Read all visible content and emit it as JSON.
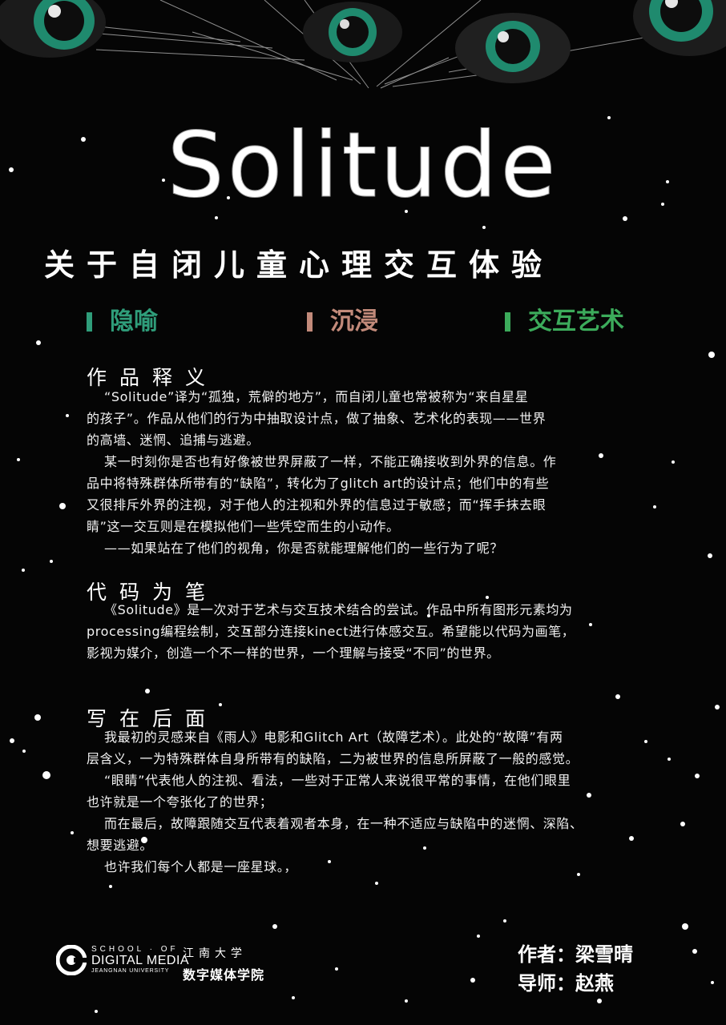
{
  "title": "Solitude",
  "subtitle": "关于自闭儿童心理交互体验",
  "tags": [
    {
      "label": "隐喻",
      "color": "#2f9d7a"
    },
    {
      "label": "沉浸",
      "color": "#c28a7a"
    },
    {
      "label": "交互艺术",
      "color": "#3cab5b"
    }
  ],
  "sections": [
    {
      "heading": "作品释义",
      "lines": [
        "“Solitude”译为“孤独，荒僻的地方”，而自闭儿童也常被称为“来自星星",
        "的孩子”。作品从他们的行为中抽取设计点，做了抽象、艺术化的表现——世界",
        "的高墙、迷惘、追捕与逃避。",
        "某一时刻你是否也有好像被世界屏蔽了一样，不能正确接收到外界的信息。作",
        "品中将特殊群体所带有的“缺陷”，转化为了glitch art的设计点；他们中的有些",
        "又很排斥外界的注视，对于他人的注视和外界的信息过于敏感；而“挥手抹去眼",
        "睛”这一交互则是在模拟他们一些凭空而生的小动作。",
        "——如果站在了他们的视角，你是否就能理解他们的一些行为了呢？"
      ]
    },
    {
      "heading": "代码为笔",
      "lines": [
        "《Solitude》是一次对于艺术与交互技术结合的尝试。作品中所有图形元素均为",
        "processing编程绘制，交互部分连接kinect进行体感交互。希望能以代码为画笔，",
        "影视为媒介，创造一个不一样的世界，一个理解与接受“不同”的世界。"
      ]
    },
    {
      "heading": "写在后面",
      "lines": [
        "我最初的灵感来自《雨人》电影和Glitch Art（故障艺术）。此处的“故障”有两",
        "层含义，一为特殊群体自身所带有的缺陷，二为被世界的信息所屏蔽了一般的感觉。",
        "“眼睛”代表他人的注视、看法，一些对于正常人来说很平常的事情，在他们眼里",
        "也许就是一个夸张化了的世界；",
        "而在最后，故障跟随交互代表着观者本身，在一种不适应与缺陷中的迷惘、深陷、",
        "想要逃避。",
        "也许我们每个人都是一座星球。，"
      ]
    }
  ],
  "school": {
    "en_line1": "SCHOOL · OF",
    "en_line2": "DIGITAL MEDIA",
    "en_line3": "JEANGNAN UNIVERSITY",
    "cn_line1": "江南大学",
    "cn_line2": "数字媒体学院"
  },
  "credits": {
    "author": "作者：梁雪晴",
    "mentor": "导师：赵燕"
  },
  "colors": {
    "background": "#050505",
    "eye_ring": "#1f8a6e",
    "text": "#ffffff"
  }
}
